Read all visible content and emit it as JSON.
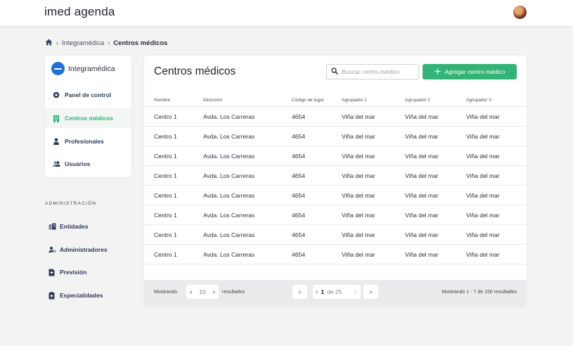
{
  "app": {
    "logo": "imed agenda"
  },
  "breadcrumb": {
    "items": [
      "Integramédica",
      "Centros médicos"
    ]
  },
  "sidebar": {
    "org_name": "Integramédica",
    "items": [
      {
        "label": "Panel de control",
        "icon": "dashboard-icon"
      },
      {
        "label": "Centros médicos",
        "icon": "building-icon",
        "active": true
      },
      {
        "label": "Profesionales",
        "icon": "doctor-icon"
      },
      {
        "label": "Usuarios",
        "icon": "users-icon"
      }
    ],
    "admin_label": "ADMINISTRACIÓN",
    "admin_items": [
      {
        "label": "Entidades",
        "icon": "entities-icon"
      },
      {
        "label": "Administradores",
        "icon": "admin-icon"
      },
      {
        "label": "Previsión",
        "icon": "document-icon"
      },
      {
        "label": "Especialidades",
        "icon": "medical-box-icon"
      }
    ]
  },
  "main": {
    "title": "Centros médicos",
    "search_placeholder": "Buscar centro médico",
    "add_button": "Agregar centro médico",
    "columns": [
      "Nombre",
      "Dirección",
      "Código de lugar",
      "Agrupador 1",
      "Agrupador 2",
      "Agrupador 3"
    ],
    "rows": [
      [
        "Centro 1",
        "Avda. Los Carreras",
        "4654",
        "Viña del mar",
        "Viña del mar",
        "Viña del mar"
      ],
      [
        "Centro 1",
        "Avda. Los Carreras",
        "4654",
        "Viña del mar",
        "Viña del mar",
        "Viña del mar"
      ],
      [
        "Centro 1",
        "Avda. Los Carreras",
        "4654",
        "Viña del mar",
        "Viña del mar",
        "Viña del mar"
      ],
      [
        "Centro 1",
        "Avda. Los Carreras",
        "4654",
        "Viña del mar",
        "Viña del mar",
        "Viña del mar"
      ],
      [
        "Centro 1",
        "Avda. Los Carreras",
        "4654",
        "Viña del mar",
        "Viña del mar",
        "Viña del mar"
      ],
      [
        "Centro 1",
        "Avda. Los Carreras",
        "4654",
        "Viña del mar",
        "Viña del mar",
        "Viña del mar"
      ],
      [
        "Centro 1",
        "Avda. Los Carreras",
        "4654",
        "Viña del mar",
        "Viña del mar",
        "Viña del mar"
      ],
      [
        "Centro 1",
        "Avda. Los Carreras",
        "4654",
        "Viña del mar",
        "Viña del mar",
        "Viña del mar"
      ]
    ]
  },
  "footer": {
    "showing_label": "Mostrando",
    "page_size": "10",
    "results_label": "resultados",
    "current_page": "1",
    "of_pages": "de 25",
    "summary": "Mostrando 1 - 7 de 150 resultados"
  },
  "colors": {
    "accent": "#34b377",
    "nav_text": "#2c3a55",
    "org_logo": "#1e6fd9"
  }
}
